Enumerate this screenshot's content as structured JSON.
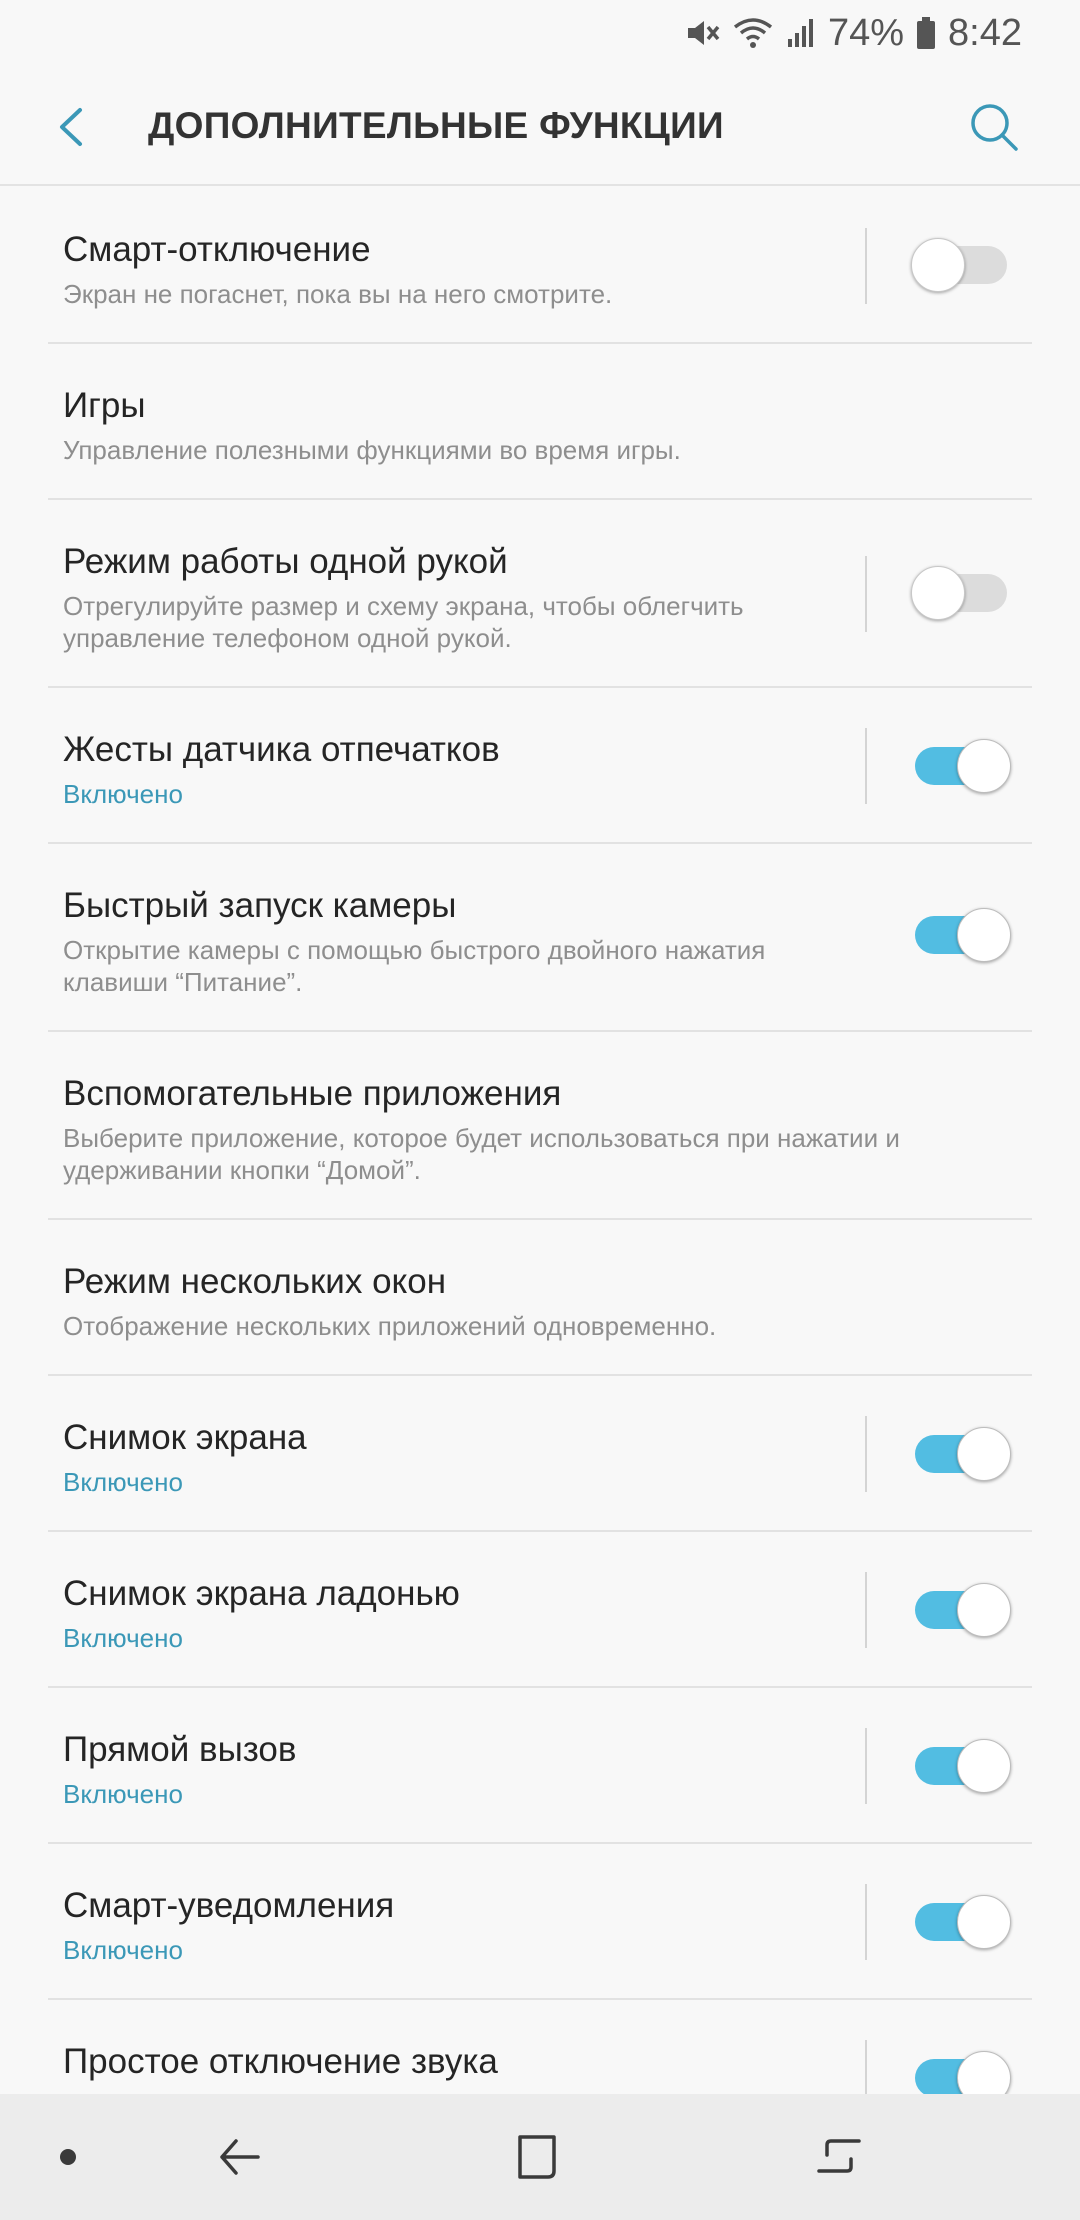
{
  "status_bar": {
    "battery": "74%",
    "time": "8:42",
    "icons": [
      "mute-icon",
      "wifi-icon",
      "signal-icon",
      "battery-icon"
    ]
  },
  "header": {
    "title": "ДОПОЛНИТЕЛЬНЫЕ ФУНКЦИИ",
    "back_icon": "back-arrow-icon",
    "search_icon": "search-icon"
  },
  "settings": [
    {
      "title": "Смарт-отключение",
      "subtitle": "Экран не погаснет, пока вы на него смотрите.",
      "toggle": false
    },
    {
      "title": "Игры",
      "subtitle": "Управление полезными функциями во время игры."
    },
    {
      "title": "Режим работы одной рукой",
      "subtitle": "Отрегулируйте размер и схему экрана, чтобы облегчить управление телефоном одной рукой.",
      "toggle": false
    },
    {
      "title": "Жесты датчика отпечатков",
      "subtitle": "Включено",
      "toggle": true
    },
    {
      "title": "Быстрый запуск камеры",
      "subtitle": "Открытие камеры с помощью быстрого двойного нажатия клавиши “Питание”.",
      "toggle": true
    },
    {
      "title": "Вспомогательные приложения",
      "subtitle": "Выберите приложение, которое будет использоваться при нажатии и удерживании кнопки “Домой”."
    },
    {
      "title": "Режим нескольких окон",
      "subtitle": "Отображение нескольких приложений одновременно."
    },
    {
      "title": "Снимок экрана",
      "subtitle": "Включено",
      "toggle": true
    },
    {
      "title": "Снимок экрана ладонью",
      "subtitle": "Включено",
      "toggle": true
    },
    {
      "title": "Прямой вызов",
      "subtitle": "Включено",
      "toggle": true
    },
    {
      "title": "Смарт-уведомления",
      "subtitle": "Включено",
      "toggle": true
    },
    {
      "title": "Простое отключение звука",
      "subtitle": "",
      "toggle": true
    }
  ],
  "nav_bar": {
    "items": [
      "dot-icon",
      "back-icon",
      "home-icon",
      "recents-icon"
    ]
  },
  "colors": {
    "accent": "#3b98b7",
    "toggle_on": "#52bde2",
    "toggle_off": "#dcdcdc",
    "background": "#f8f8f8",
    "navbar": "#ececec"
  }
}
